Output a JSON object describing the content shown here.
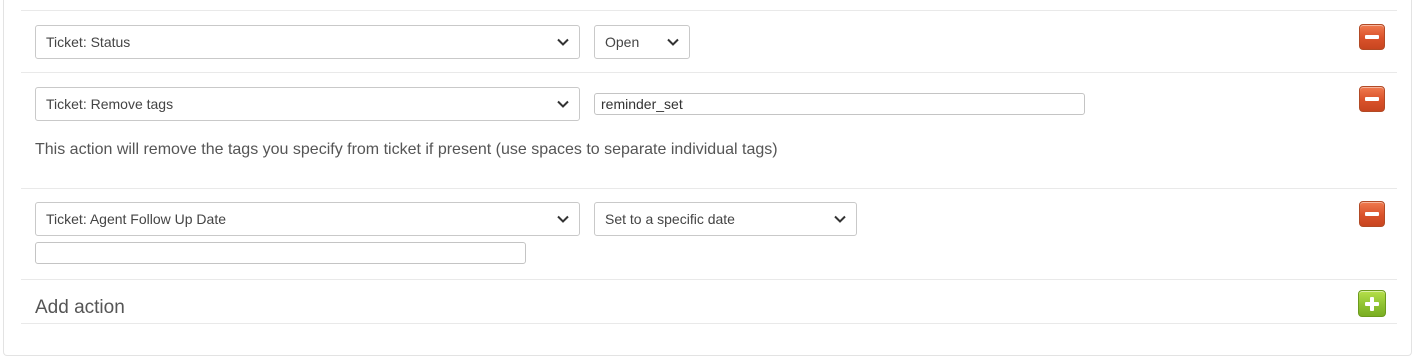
{
  "actions": [
    {
      "field": "Ticket: Status",
      "operator": "Open"
    },
    {
      "field": "Ticket: Remove tags",
      "value": "reminder_set",
      "help_text": "This action will remove the tags you specify from ticket if present (use spaces to separate individual tags)"
    },
    {
      "field": "Ticket: Agent Follow Up Date",
      "operator": "Set to a specific date",
      "value": ""
    }
  ],
  "add_action_label": "Add action",
  "colors": {
    "remove_button": "#d9522a",
    "add_button": "#8fc232",
    "text": "#555555",
    "border": "#c9c9c9"
  },
  "icons": {
    "dropdown": "chevron-down-icon",
    "remove": "minus-icon",
    "add": "plus-icon"
  }
}
